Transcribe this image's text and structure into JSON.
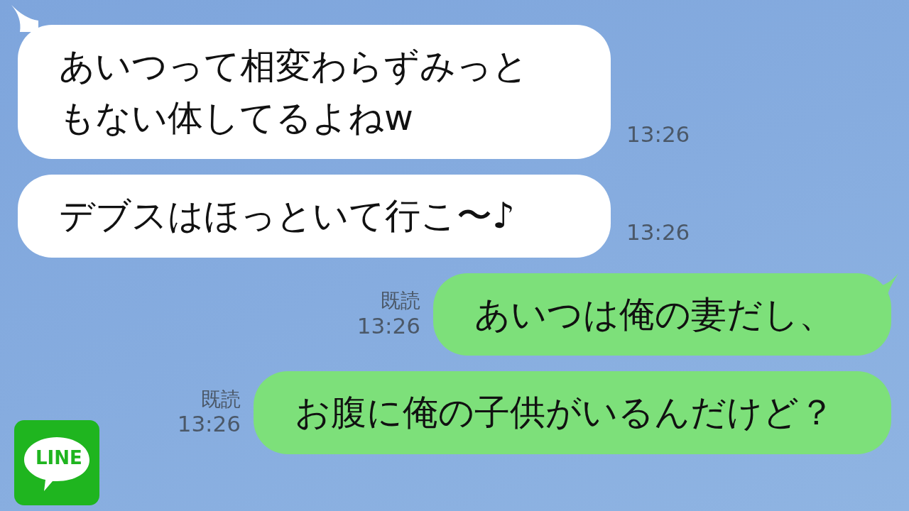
{
  "messages": [
    {
      "kind": "received",
      "text": "あいつって相変わらずみっともない体してるよねw",
      "time": "13:26",
      "tail": true
    },
    {
      "kind": "received",
      "text": "デブスはほっといて行こ〜♪",
      "time": "13:26",
      "tail": false
    },
    {
      "kind": "sent",
      "text": "あいつは俺の妻だし、",
      "read_label": "既読",
      "time": "13:26",
      "tail": true
    },
    {
      "kind": "sent",
      "text": "お腹に俺の子供がいるんだけど？",
      "read_label": "既読",
      "time": "13:26",
      "tail": false
    }
  ],
  "logo": {
    "text": "LINE"
  }
}
